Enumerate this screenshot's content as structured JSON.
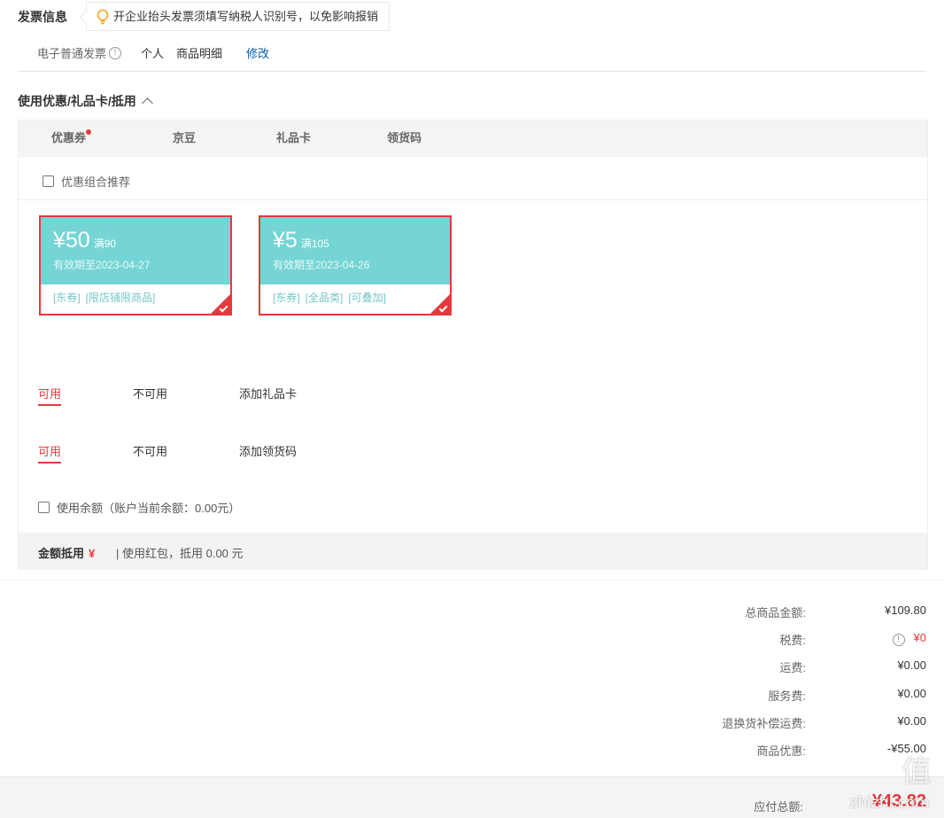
{
  "invoice": {
    "title": "发票信息",
    "tip": "开企业抬头发票须填写纳税人识别号，以免影响报销",
    "type": "电子普通发票",
    "info_glyph": "!",
    "holder": "个人",
    "content": "商品明细",
    "modify_link": "修改"
  },
  "discount_section": {
    "title": "使用优惠/礼品卡/抵用",
    "tabs": [
      {
        "label": "优惠券",
        "has_dot": true
      },
      {
        "label": "京豆"
      },
      {
        "label": "礼品卡"
      },
      {
        "label": "领货码"
      }
    ],
    "combo_label": "优惠组合推荐",
    "coupons": [
      {
        "amount": "¥50",
        "condition": "满90",
        "expire": "有效期至2023-04-27",
        "tags": [
          "[东券]",
          "[限店铺限商品]"
        ],
        "selected": true
      },
      {
        "amount": "¥5",
        "condition": "满105",
        "expire": "有效期至2023-04-26",
        "tags": [
          "[东券]",
          "[全品类]",
          "[可叠加]"
        ],
        "selected": true
      }
    ],
    "gift_card_tabs": [
      "可用",
      "不可用",
      "添加礼品卡"
    ],
    "pickup_code_tabs": [
      "可用",
      "不可用",
      "添加领货码"
    ],
    "balance_label": "使用余额（账户当前余额：0.00元）",
    "deduct": {
      "label": "金额抵用",
      "yen": "¥",
      "text": "| 使用红包，抵用 0.00 元"
    }
  },
  "summary": [
    {
      "label": "总商品金额:",
      "value": "¥109.80"
    },
    {
      "label": "税费:",
      "value": "¥0",
      "icon": "info-icon",
      "glyph": "!"
    },
    {
      "label": "运费:",
      "value": "¥0.00"
    },
    {
      "label": "服务费:",
      "value": "¥0.00"
    },
    {
      "label": "退换货补偿运费:",
      "value": "¥0.00"
    },
    {
      "label": "商品优惠:",
      "value": "-¥55.00"
    }
  ],
  "total": {
    "label": "应付总额:",
    "value": "¥43.82"
  },
  "watermark": {
    "logo": "值",
    "site": "zhizhi.com"
  },
  "colors": {
    "accent": "#e4393c",
    "coupon": "#75d4d4",
    "link": "#005ea7"
  }
}
